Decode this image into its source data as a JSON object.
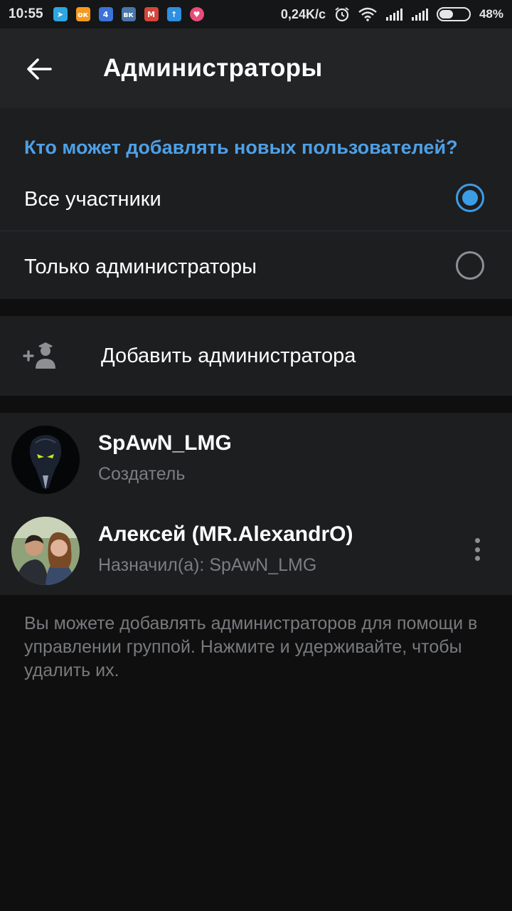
{
  "status_bar": {
    "time": "10:55",
    "net_speed": "0,24K/c",
    "battery_percent": "48%",
    "battery_level": 0.48,
    "notifications": [
      {
        "name": "telegram-icon",
        "color": "#2ea6e0",
        "glyph": "➤"
      },
      {
        "name": "odnoklassniki-icon",
        "color": "#f59a1f",
        "glyph": "ок"
      },
      {
        "name": "news-icon",
        "color": "#3a73d8",
        "glyph": "4"
      },
      {
        "name": "vk-icon",
        "color": "#4a76a8",
        "glyph": "вк"
      },
      {
        "name": "gmail-icon",
        "color": "#d44638",
        "glyph": "M"
      },
      {
        "name": "upload-icon",
        "color": "#2f8fe0",
        "glyph": "↑"
      },
      {
        "name": "heart-app-icon",
        "color": "#e84d7a",
        "glyph": "♥"
      }
    ]
  },
  "toolbar": {
    "title": "Администраторы"
  },
  "who_can_add": {
    "header": "Кто может добавлять новых пользователей?",
    "options": [
      {
        "label": "Все участники",
        "selected": true
      },
      {
        "label": "Только администраторы",
        "selected": false
      }
    ]
  },
  "add_admin": {
    "label": "Добавить администратора"
  },
  "admins": [
    {
      "name": "SpAwN_LMG",
      "subtitle": "Создатель"
    },
    {
      "name": "Алексей (MR.AlexandrO)",
      "subtitle": "Назначил(а): SpAwN_LMG"
    }
  ],
  "info_text": "Вы можете добавлять администраторов для помощи в управлении группой. Нажмите и удерживайте, чтобы удалить их.",
  "colors": {
    "accent": "#3b9de6",
    "header_blue": "#4ea0e6",
    "toolbar_bg": "#222426",
    "section_bg": "#1d1e20",
    "page_bg": "#0f0f10"
  }
}
